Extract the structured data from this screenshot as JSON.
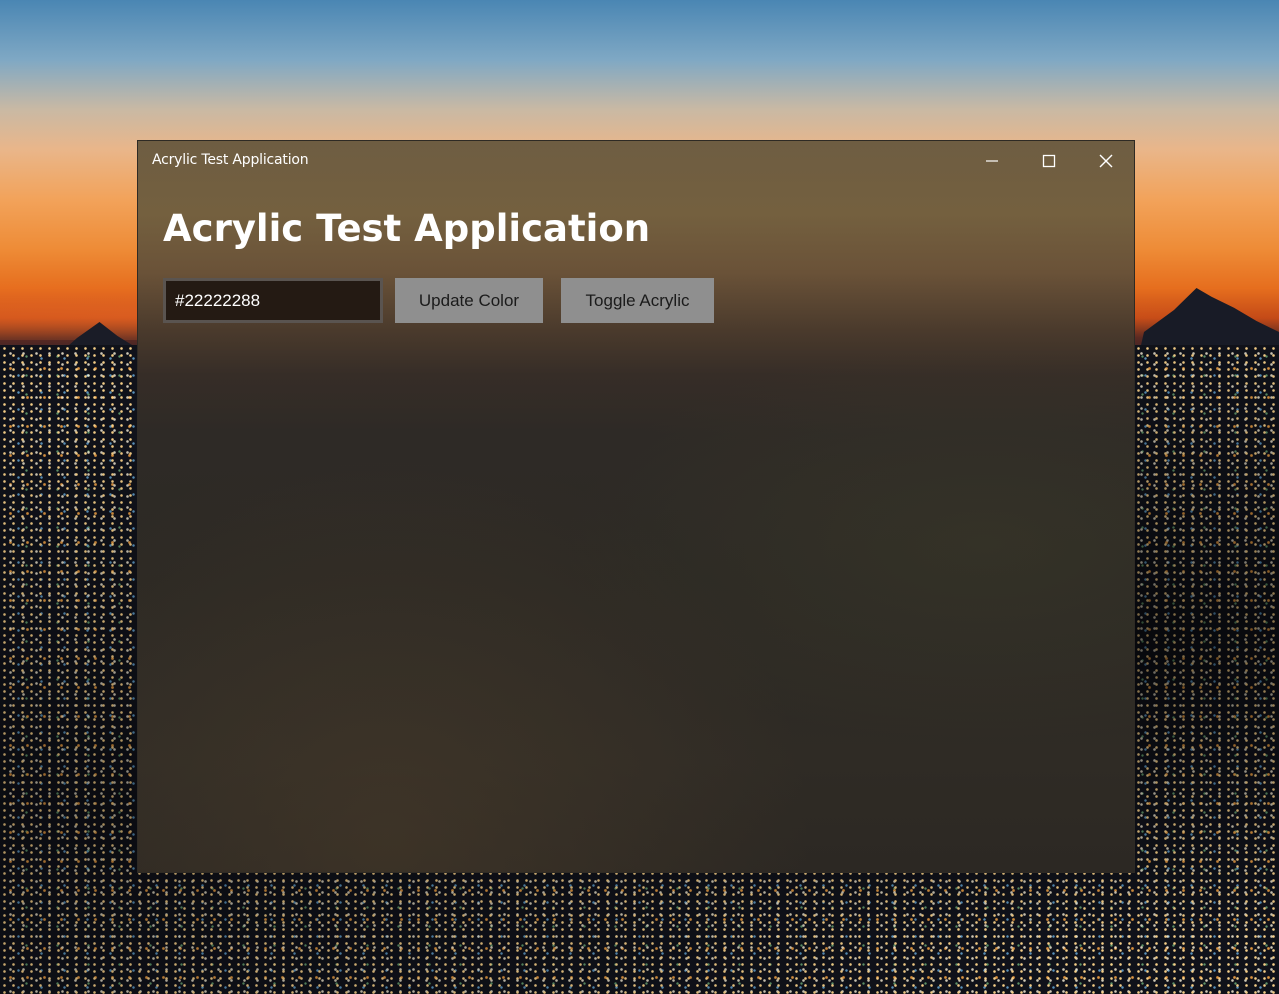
{
  "window": {
    "title": "Acrylic Test Application",
    "controls": {
      "minimize_icon": "minimize-icon",
      "maximize_icon": "maximize-icon",
      "close_icon": "close-icon"
    }
  },
  "main": {
    "heading": "Acrylic Test Application",
    "color_input": {
      "value": "#22222288"
    },
    "update_button_label": "Update Color",
    "toggle_button_label": "Toggle Acrylic"
  },
  "colors": {
    "button_background": "#8f8f8f",
    "input_background": "#241a13",
    "input_border": "#5a5450",
    "text": "#ffffff"
  }
}
